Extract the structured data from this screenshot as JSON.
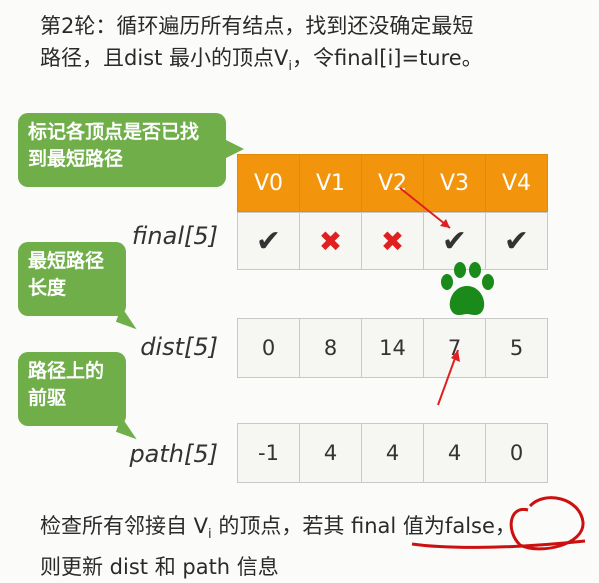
{
  "title": {
    "line1": "第2轮：循环遍历所有结点，找到还没确定最短",
    "line2_pre": "路径，且dist 最小的顶点V",
    "line2_sub": "i",
    "line2_post": "，令final[i]=ture。"
  },
  "bubbles": {
    "final_note": "标记各顶点是否已找到最短路径",
    "dist_note": "最短路径长度",
    "path_note": "路径上的前驱"
  },
  "rows": {
    "final_label": "final[5]",
    "dist_label": "dist[5]",
    "path_label": "path[5]"
  },
  "vertices": [
    "V0",
    "V1",
    "V2",
    "V3",
    "V4"
  ],
  "final": [
    "✔",
    "✖",
    "✖",
    "✔",
    "✔"
  ],
  "dist": [
    "0",
    "8",
    "14",
    "7",
    "5"
  ],
  "path": [
    "-1",
    "4",
    "4",
    "4",
    "0"
  ],
  "footer": {
    "pre": "检查所有邻接自 V",
    "sub": "i",
    "mid": " 的顶点，若其 final 值为false，",
    "line2": "则更新 dist 和 path 信息"
  },
  "colors": {
    "header_bg": "#f2950c",
    "bubble_bg": "#6fae48",
    "cross": "#e02020",
    "paw": "#1a8a1a",
    "annotation": "#e02020"
  }
}
